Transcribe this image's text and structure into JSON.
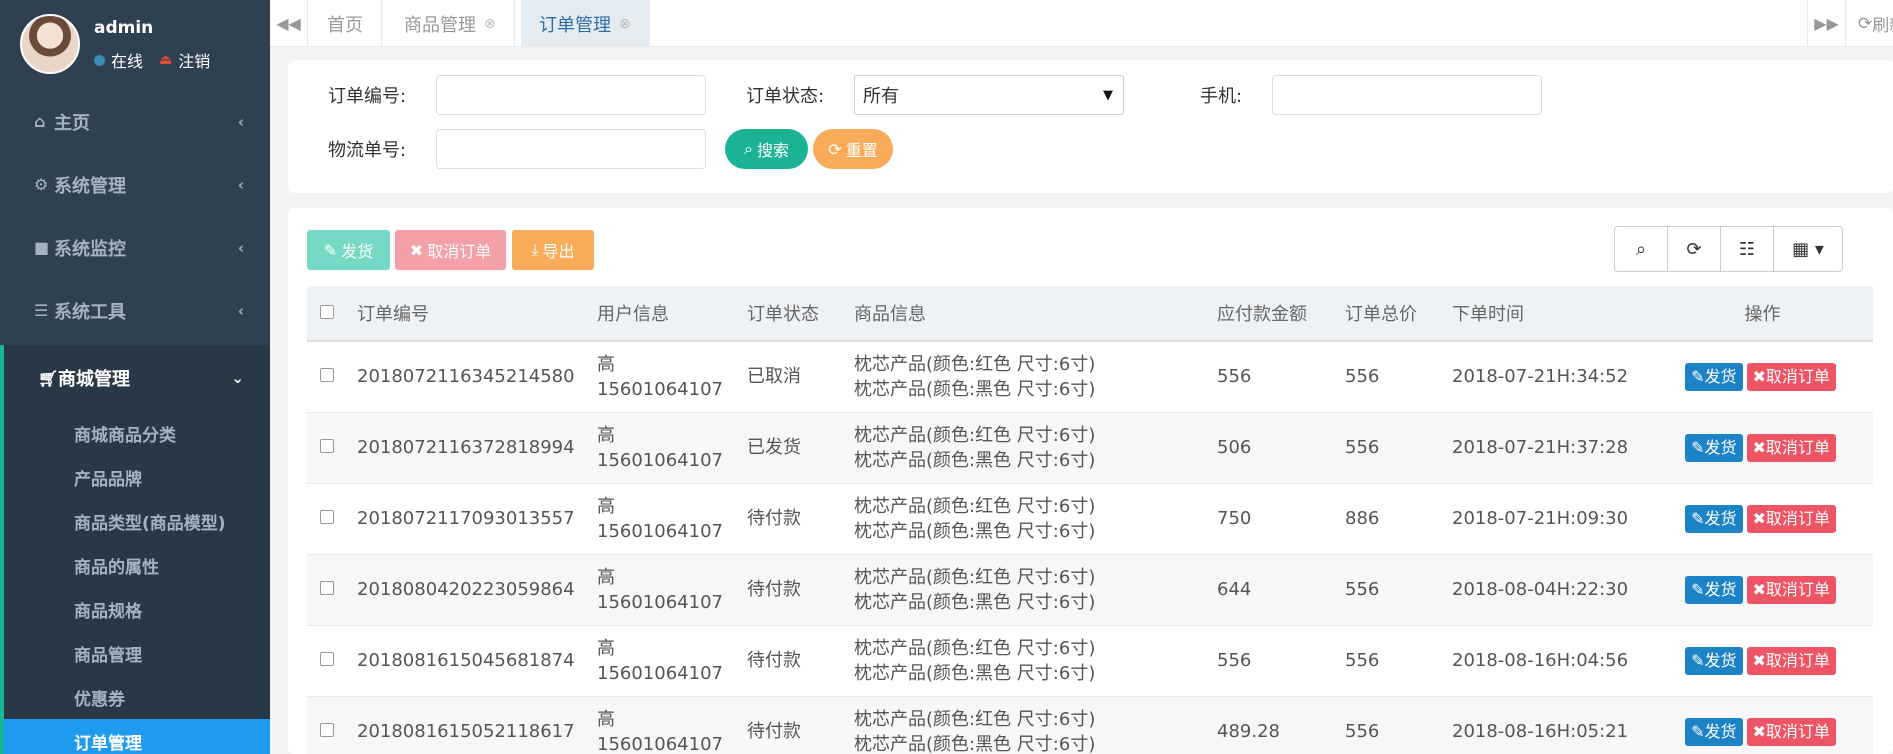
{
  "user": {
    "name": "admin",
    "status": "在线",
    "logout": "注销"
  },
  "menu": {
    "items": [
      {
        "label": "主页",
        "icon": "home-icon"
      },
      {
        "label": "系统管理",
        "icon": "gear-icon"
      },
      {
        "label": "系统监控",
        "icon": "video-camera-icon"
      },
      {
        "label": "系统工具",
        "icon": "bars-icon"
      }
    ],
    "active_group": {
      "label": "商城管理",
      "icon": "cart-icon"
    },
    "sub_items": [
      "商城商品分类",
      "产品品牌",
      "商品类型(商品模型)",
      "商品的属性",
      "商品规格",
      "商品管理",
      "优惠券",
      "订单管理"
    ],
    "active_sub": "订单管理"
  },
  "tabs": [
    {
      "label": "首页"
    },
    {
      "label": "商品管理"
    },
    {
      "label": "订单管理"
    }
  ],
  "refresh_label": "刷新",
  "search": {
    "order_no_label": "订单编号:",
    "status_label": "订单状态:",
    "status_value": "所有",
    "phone_label": "手机:",
    "logistics_label": "物流单号:",
    "search_btn": "搜索",
    "reset_btn": "重置"
  },
  "toolbar": {
    "ship": "发货",
    "cancel": "取消订单",
    "export": "导出"
  },
  "colors": {
    "sidebar": "#2f4050",
    "accent_green": "#1ab394",
    "blue": "#1c84c6",
    "red": "#ed5565",
    "orange": "#f8ac59"
  },
  "table": {
    "columns": [
      "订单编号",
      "用户信息",
      "订单状态",
      "商品信息",
      "应付款金额",
      "订单总价",
      "下单时间",
      "操作"
    ],
    "action_ship": "发货",
    "action_cancel": "取消订单",
    "rows": [
      {
        "order_no": "2018072116345214580",
        "user_name": "高",
        "user_phone": "15601064107",
        "status": "已取消",
        "goods1": "枕芯产品(颜色:红色 尺寸:6寸)",
        "goods2": "枕芯产品(颜色:黑色 尺寸:6寸)",
        "payable": "556",
        "total": "556",
        "time": "2018-07-21H:34:52"
      },
      {
        "order_no": "2018072116372818994",
        "user_name": "高",
        "user_phone": "15601064107",
        "status": "已发货",
        "goods1": "枕芯产品(颜色:红色 尺寸:6寸)",
        "goods2": "枕芯产品(颜色:黑色 尺寸:6寸)",
        "payable": "506",
        "total": "556",
        "time": "2018-07-21H:37:28"
      },
      {
        "order_no": "2018072117093013557",
        "user_name": "高",
        "user_phone": "15601064107",
        "status": "待付款",
        "goods1": "枕芯产品(颜色:红色 尺寸:6寸)",
        "goods2": "枕芯产品(颜色:黑色 尺寸:6寸)",
        "payable": "750",
        "total": "886",
        "time": "2018-07-21H:09:30"
      },
      {
        "order_no": "2018080420223059864",
        "user_name": "高",
        "user_phone": "15601064107",
        "status": "待付款",
        "goods1": "枕芯产品(颜色:红色 尺寸:6寸)",
        "goods2": "枕芯产品(颜色:黑色 尺寸:6寸)",
        "payable": "644",
        "total": "556",
        "time": "2018-08-04H:22:30"
      },
      {
        "order_no": "2018081615045681874",
        "user_name": "高",
        "user_phone": "15601064107",
        "status": "待付款",
        "goods1": "枕芯产品(颜色:红色 尺寸:6寸)",
        "goods2": "枕芯产品(颜色:黑色 尺寸:6寸)",
        "payable": "556",
        "total": "556",
        "time": "2018-08-16H:04:56"
      },
      {
        "order_no": "2018081615052118617",
        "user_name": "高",
        "user_phone": "15601064107",
        "status": "待付款",
        "goods1": "枕芯产品(颜色:红色 尺寸:6寸)",
        "goods2": "枕芯产品(颜色:黑色 尺寸:6寸)",
        "payable": "489.28",
        "total": "556",
        "time": "2018-08-16H:05:21"
      }
    ]
  }
}
